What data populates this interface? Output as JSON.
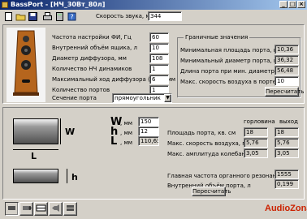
{
  "window": {
    "title": "BassPort - [НЧ_30Вт_80л]"
  },
  "toolbar": {
    "sound_speed_label": "Скорость звука, м/с",
    "sound_speed_value": "344"
  },
  "params": [
    {
      "label": "Частота настройки ФИ, Гц",
      "value": "60"
    },
    {
      "label": "Внутренний объём ящика, л",
      "value": "10"
    },
    {
      "label": "Диаметр диффузора, мм",
      "value": "108"
    },
    {
      "label": "Количество НЧ динамиков",
      "value": "1"
    },
    {
      "label": "Максимальный ход диффузора (mm), мм",
      "value": "6"
    },
    {
      "label": "Количество портов",
      "value": "1"
    }
  ],
  "port_section": {
    "label": "Сечение порта",
    "value": "прямоугольник"
  },
  "limits": {
    "title": "Граничные значения",
    "rows": [
      {
        "label": "Минимальная площадь порта, кв.см.",
        "value": "10,36"
      },
      {
        "label": "Минимальный диаметр порта, мм",
        "value": "36,32"
      },
      {
        "label": "Длина порта при мин. диаметре, мм",
        "value": "56,48"
      },
      {
        "label": "Макс. скорость воздуха в порте, м/с",
        "value": "10"
      }
    ],
    "recalc": "Пересчитать"
  },
  "dims": {
    "W": {
      "letter": "W",
      "unit": ", мм",
      "value": "150"
    },
    "h": {
      "letter": "h",
      "unit": ", мм",
      "value": "12"
    },
    "L": {
      "letter": "L",
      "unit": ", мм",
      "value": "110,63"
    }
  },
  "diagram": {
    "w": "W",
    "l": "L",
    "h": "h"
  },
  "results": {
    "col1": "горловина",
    "col2": "выход",
    "rows": [
      {
        "label": "Площадь порта, кв. см",
        "v1": "18",
        "v2": "18"
      },
      {
        "label": "Макс. скорость воздуха, м/с",
        "v1": "5,76",
        "v2": "5,76"
      },
      {
        "label": "Макс. амплитуда колебаний, см",
        "v1": "3,05",
        "v2": "3,05"
      }
    ]
  },
  "resonance": {
    "rows": [
      {
        "label": "Главная частота органного резонанса, Гц",
        "value": "1555"
      },
      {
        "label": "Внутренний объём порта, л",
        "value": "0,199"
      }
    ],
    "recalc": "Пересчитать"
  },
  "watermark": "AudioZona",
  "colors": {
    "title_start": "#0a246a",
    "title_end": "#a6caf0",
    "face": "#d4d0c8",
    "watermark": "#cc2200"
  }
}
